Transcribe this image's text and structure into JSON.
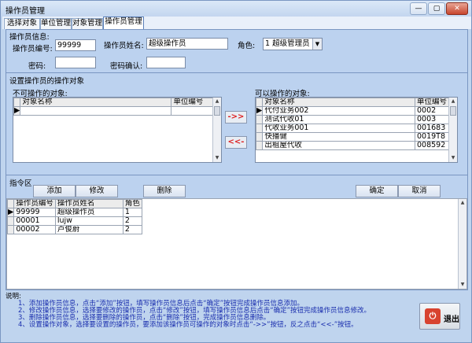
{
  "window": {
    "title": "操作员管理",
    "btn_min": "—",
    "btn_max": "▢",
    "btn_close": "✕"
  },
  "tabs": [
    "选择对象",
    "单位管理",
    "对象管理",
    "操作员管理"
  ],
  "info": {
    "header": "操作员信息:",
    "id_label": "操作员编号:",
    "id_value": "99999",
    "name_label": "操作员姓名:",
    "name_value": "超级操作员",
    "role_label": "角色:",
    "role_value": "1  超级管理员",
    "pwd_label": "密码:",
    "pwd_value": "",
    "pwd_confirm_label": "密码确认:",
    "pwd_confirm_value": ""
  },
  "objects": {
    "header": "设置操作员的操作对象",
    "left_label": "不可操作的对象:",
    "right_label": "可以操作的对象:",
    "col_name": "对象名称",
    "col_unit": "单位编号",
    "add_arrow": "->>",
    "remove_arrow": "<<-",
    "right_rows": [
      {
        "name": "代付业务002",
        "unit": "0002"
      },
      {
        "name": "测试代收01",
        "unit": "0003"
      },
      {
        "name": "代收业务001",
        "unit": "001683"
      },
      {
        "name": "快播健",
        "unit": "0019T8"
      },
      {
        "name": "出租屋代收",
        "unit": "008592"
      }
    ]
  },
  "cmd": {
    "header": "指令区",
    "add": "添加",
    "edit": "修改",
    "delete": "删除",
    "ok": "确定",
    "cancel": "取消"
  },
  "ops": {
    "col_id": "操作员编号",
    "col_name": "操作员姓名",
    "col_role": "角色",
    "rows": [
      {
        "id": "99999",
        "name": "超级操作员",
        "role": "1"
      },
      {
        "id": "00001",
        "name": "lujw",
        "role": "2"
      },
      {
        "id": "00002",
        "name": "卢俊蔚",
        "role": "2"
      }
    ]
  },
  "help": {
    "title": "说明:",
    "lines": [
      "1、添加操作员信息，点击“添加”按钮，填写操作员信息后点击“确定”按钮完成操作员信息添加。",
      "2、修改操作员信息，选择要修改的操作员，点击“修改”按钮，填写操作员信息后点击“确定”按钮完成操作员信息修改。",
      "3、删除操作员信息，选择要删除的操作员，点击“删除”按钮，完成操作员信息删除。",
      "4、设置操作对象，选择要设置的操作员，要添加该操作员可操作的对象时点击“->>”按钮，反之点击“<<-”按钮。"
    ]
  },
  "exit_label": "退出"
}
